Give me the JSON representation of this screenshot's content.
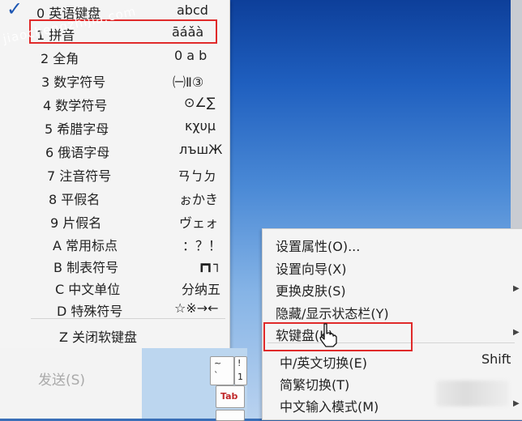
{
  "watermark": "jiaochengzhijia.com",
  "soft_keyboard_menu": {
    "items": [
      {
        "label": "0 英语键盘",
        "preview": "abcd",
        "checked": true
      },
      {
        "label": "1 拼音",
        "preview": "āáǎà"
      },
      {
        "label": "2 全角",
        "preview": "0 a b"
      },
      {
        "label": "3 数字符号",
        "preview": "㈠Ⅱ③"
      },
      {
        "label": "4 数学符号",
        "preview": "⊙∠∑"
      },
      {
        "label": "5 希腊字母",
        "preview": "κχυμ"
      },
      {
        "label": "6 俄语字母",
        "preview": "лъшЖ"
      },
      {
        "label": "7 注音符号",
        "preview": "ㄢㄅㄉ"
      },
      {
        "label": "8 平假名",
        "preview": "ぉかき"
      },
      {
        "label": "9 片假名",
        "preview": "ヴェォ"
      },
      {
        "label": "A 常用标点",
        "preview": "：？！"
      },
      {
        "label": "B 制表符号",
        "preview": "┏┓┐"
      },
      {
        "label": "C 中文单位",
        "preview": "分纳五"
      },
      {
        "label": "D 特殊符号",
        "preview": "☆※→←"
      }
    ],
    "close_label": "Z 关闭软键盘"
  },
  "chat": {
    "send_label": "发送(S)",
    "keys": {
      "tab": "Tab",
      "tilde": "~",
      "tilde_lower": "`",
      "one": "1",
      "one_upper": "!"
    }
  },
  "context_menu": {
    "items": [
      {
        "label": "设置属性(O)..."
      },
      {
        "label": "设置向导(X)"
      },
      {
        "label": "更换皮肤(S)",
        "submenu": true
      },
      {
        "label": "隐藏/显示状态栏(Y)"
      },
      {
        "label": "软键盘(K)",
        "submenu": true
      },
      {
        "label": "中/英文切换(E)",
        "shortcut": "Shift"
      },
      {
        "label": "简繁切换(T)"
      },
      {
        "label": "中文输入模式(M)",
        "submenu": true
      }
    ]
  },
  "colors": {
    "highlight_border": "#e02a2a",
    "check": "#1d57b3",
    "desktop": "#1f5fbf"
  },
  "icons": {
    "check": "checkmark-icon",
    "submenu": "triangle-right-icon",
    "cursor": "hand-pointer-icon"
  }
}
